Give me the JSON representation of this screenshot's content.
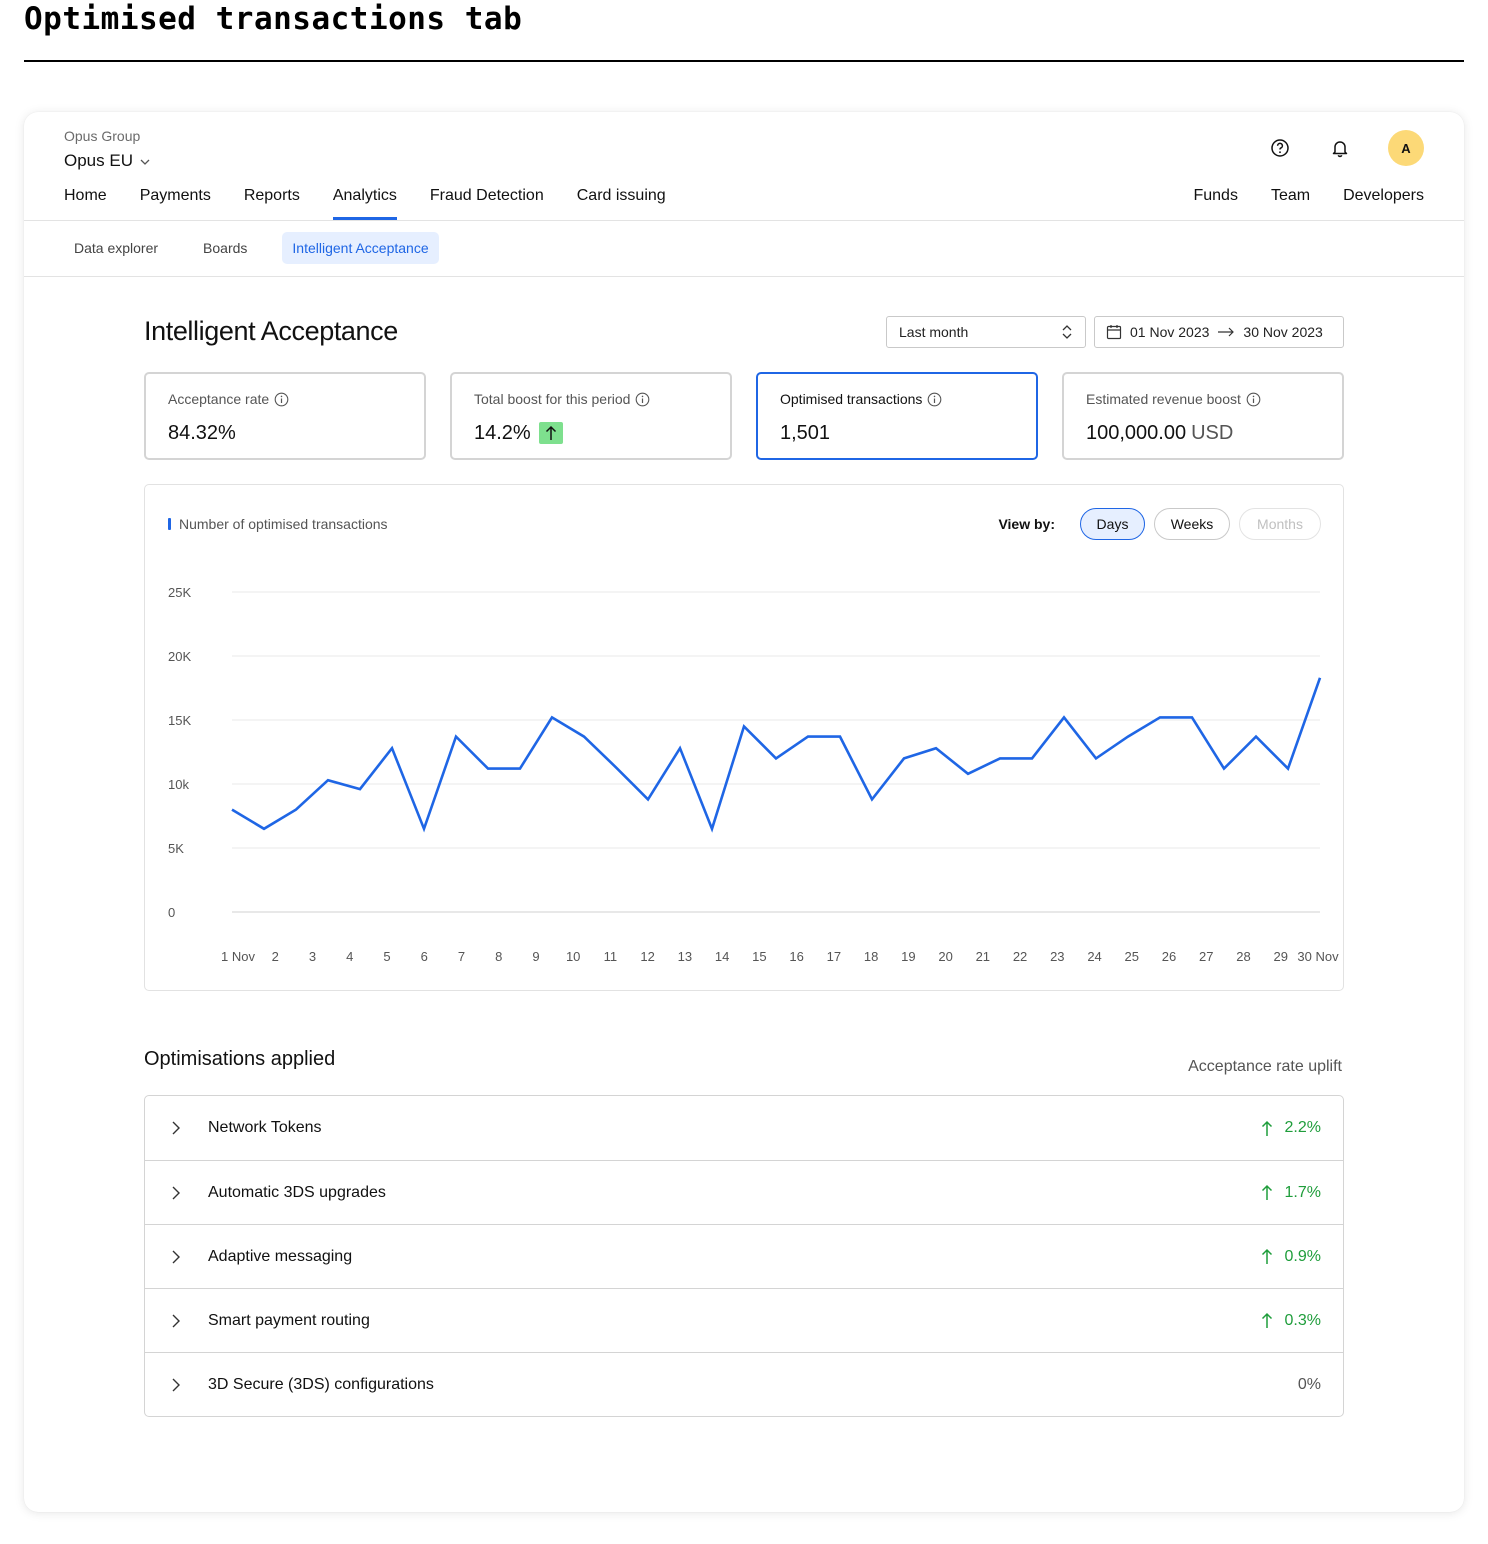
{
  "doc": {
    "title": "Optimised transactions tab"
  },
  "header": {
    "org_name": "Opus Group",
    "account_name": "Opus EU",
    "avatar_initial": "A"
  },
  "nav": {
    "main": [
      "Home",
      "Payments",
      "Reports",
      "Analytics",
      "Fraud Detection",
      "Card issuing"
    ],
    "active": "Analytics",
    "right": [
      "Funds",
      "Team",
      "Developers"
    ]
  },
  "subnav": {
    "items": [
      "Data explorer",
      "Boards",
      "Intelligent Acceptance"
    ],
    "active": "Intelligent Acceptance"
  },
  "page": {
    "title": "Intelligent Acceptance",
    "period": "Last month",
    "date_from": "01 Nov 2023",
    "date_to": "30 Nov 2023"
  },
  "kpis": [
    {
      "label": "Acceptance rate",
      "value": "84.32%"
    },
    {
      "label": "Total boost for this period",
      "value": "14.2%",
      "trend": "up"
    },
    {
      "label": "Optimised transactions",
      "value": "1,501",
      "selected": true
    },
    {
      "label": "Estimated revenue boost",
      "value": "100,000.00",
      "unit": "USD"
    }
  ],
  "chart": {
    "legend": "Number of optimised transactions",
    "view_by_label": "View by:",
    "view_options": [
      "Days",
      "Weeks",
      "Months"
    ],
    "active_view": "Days",
    "disabled_views": [
      "Months"
    ]
  },
  "chart_data": {
    "type": "line",
    "series": [
      {
        "values": [
          8000,
          6500,
          8000,
          10300,
          9600,
          12800,
          6500,
          13700,
          11200,
          11200,
          15200,
          13700,
          11300,
          8800,
          12800,
          6500,
          14500,
          12000,
          13700,
          13700,
          8800,
          12000,
          12800,
          10800,
          12000,
          12000,
          15200,
          12000,
          13700,
          15200,
          15200,
          11200,
          13700,
          11200,
          18300
        ]
      }
    ],
    "x_ticks": [
      "1 Nov",
      "2",
      "3",
      "4",
      "5",
      "6",
      "7",
      "8",
      "9",
      "10",
      "11",
      "12",
      "13",
      "14",
      "15",
      "16",
      "17",
      "18",
      "19",
      "20",
      "21",
      "22",
      "23",
      "24",
      "25",
      "26",
      "27",
      "28",
      "29",
      "30 Nov"
    ],
    "y_ticks": [
      "25K",
      "20K",
      "15K",
      "10k",
      "5K",
      "0"
    ],
    "ylim": [
      0,
      25000
    ],
    "grid": true,
    "color": "#1f66e5"
  },
  "optimisations": {
    "title": "Optimisations applied",
    "column_header": "Acceptance rate uplift",
    "rows": [
      {
        "name": "Network Tokens",
        "uplift": "2.2%",
        "trend": "up"
      },
      {
        "name": "Automatic 3DS upgrades",
        "uplift": "1.7%",
        "trend": "up"
      },
      {
        "name": "Adaptive messaging",
        "uplift": "0.9%",
        "trend": "up"
      },
      {
        "name": "Smart payment routing",
        "uplift": "0.3%",
        "trend": "up"
      },
      {
        "name": "3D Secure (3DS) configurations",
        "uplift": "0%",
        "trend": "none"
      }
    ]
  },
  "colors": {
    "accent": "#1f66e5",
    "accent_bg": "#e6efff",
    "avatar": "#fcd977",
    "positive": "#1f9d3b",
    "badge_green": "#7ee08e"
  }
}
